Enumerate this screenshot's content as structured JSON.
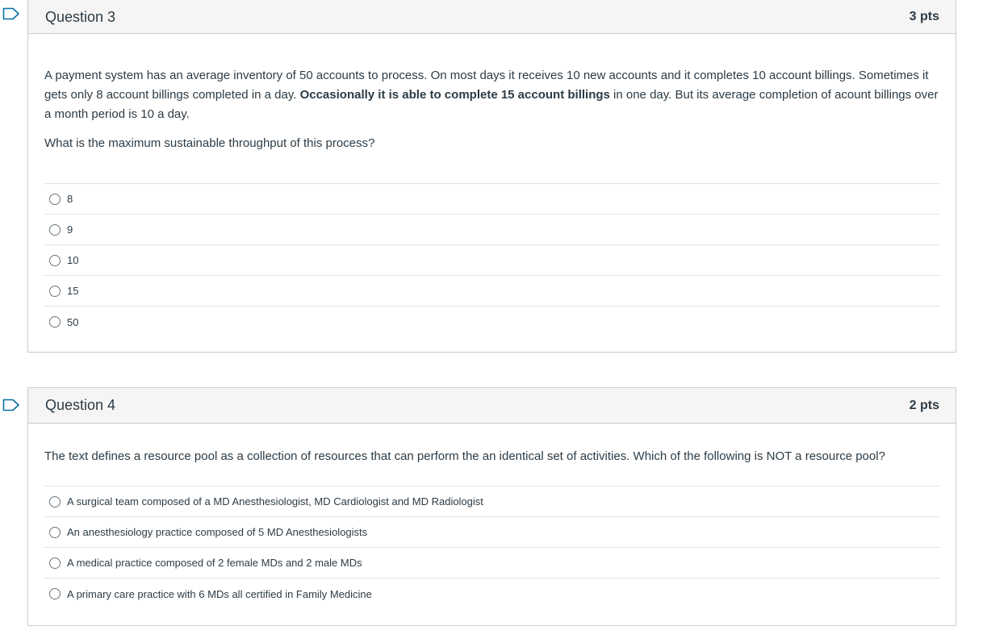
{
  "colors": {
    "flag": "#0770a3",
    "border": "#c7cdd1",
    "header_bg": "#f5f5f5",
    "text": "#2d3b45"
  },
  "questions": [
    {
      "title": "Question 3",
      "points": "3 pts",
      "text": {
        "p1_a": "A payment system has an average inventory of 50 accounts to process. On most days it receives 10 new accounts and it completes 10 account billings. Sometimes it gets only 8 account billings completed in a day. ",
        "p1_bold": "Occasionally it is able to complete 15 account billings",
        "p1_b": " in one day.  But its average completion of acount billings over a month period is 10 a day.",
        "p2": "What is the maximum sustainable throughput of this process?"
      },
      "answers": [
        "8",
        "9",
        "10",
        "15",
        "50"
      ]
    },
    {
      "title": "Question 4",
      "points": "2 pts",
      "text": {
        "p1": "The text defines a resource pool as a collection of resources that can perform the an identical set of activities. Which of the following is NOT a resource pool?"
      },
      "answers": [
        "A surgical team composed of a MD Anesthesiologist, MD Cardiologist and MD Radiologist",
        "An anesthesiology practice composed of 5 MD Anesthesiologists",
        "A medical practice composed of 2 female MDs and 2 male MDs",
        "A primary care practice with 6 MDs all certified in Family Medicine"
      ]
    }
  ]
}
